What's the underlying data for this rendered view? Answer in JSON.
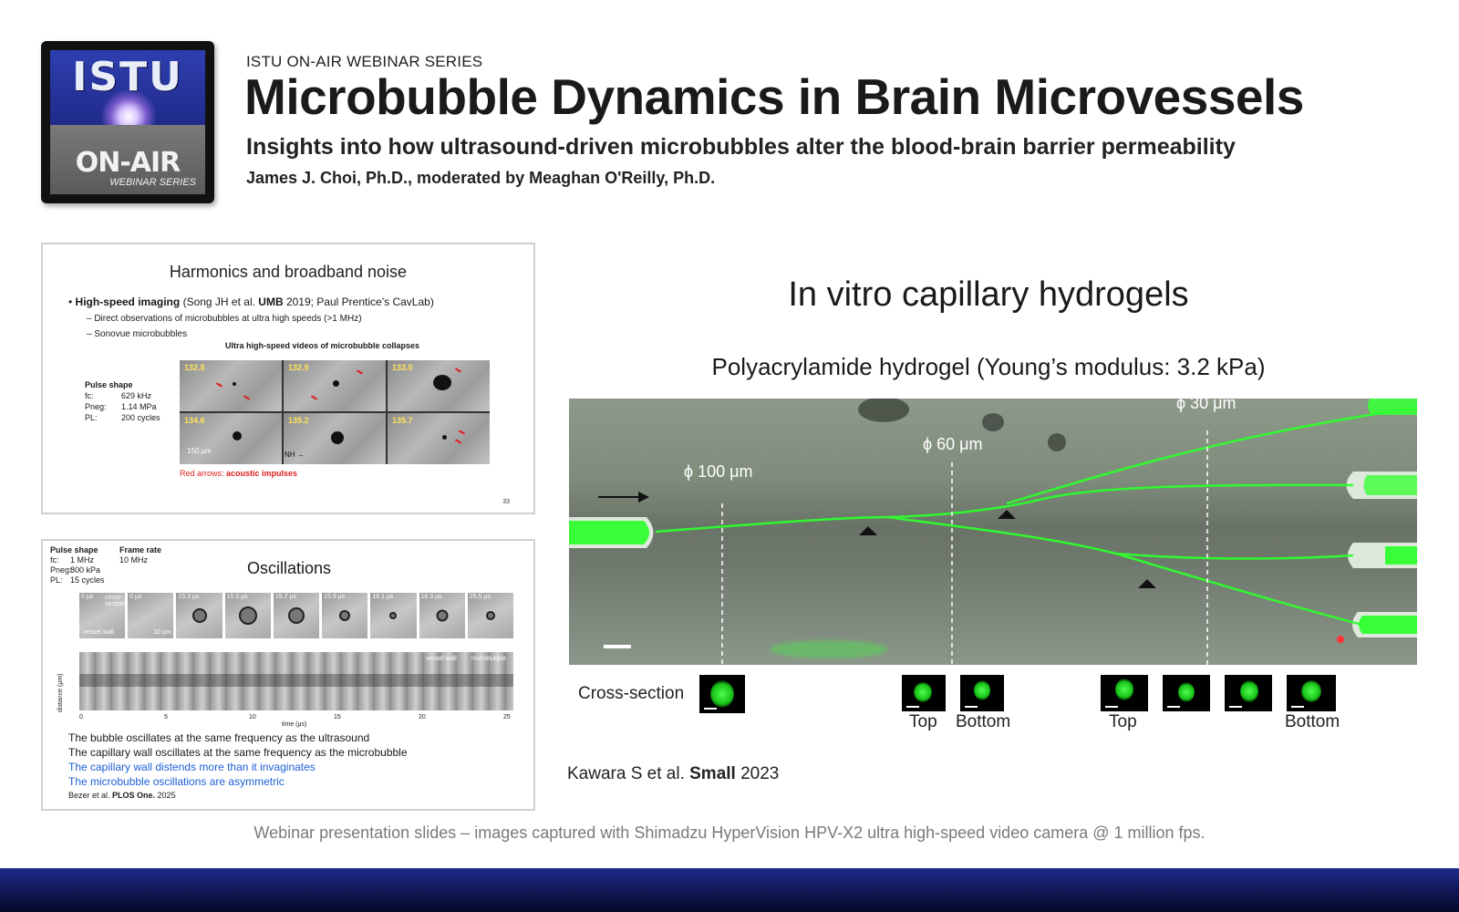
{
  "header": {
    "series": "ISTU ON-AIR WEBINAR SERIES",
    "title": "Microbubble Dynamics in Brain Microvessels",
    "subtitle": "Insights into how ultrasound-driven microbubbles alter the blood-brain barrier permeability",
    "authors": "James J. Choi, Ph.D., moderated by Meaghan O'Reilly, Ph.D."
  },
  "logo": {
    "top_text": "ISTU",
    "middle_text": "ON-AIR",
    "bottom_text": "WEBINAR SERIES"
  },
  "slide1": {
    "heading": "Harmonics and broadband noise",
    "bullet_bold": "High-speed imaging",
    "bullet_rest_1": " (Song JH et al. ",
    "bullet_bold_2": "UMB",
    "bullet_rest_2": " 2019; Paul Prentice’s CavLab)",
    "sub1": "–  Direct observations of microbubbles at ultra high speeds (>1 MHz)",
    "sub2": "–  Sonovue microbubbles",
    "video_title": "Ultra high-speed videos of microbubble collapses",
    "frames": [
      "132.8",
      "132.9",
      "133.0",
      "134.6",
      "135.2",
      "135.7"
    ],
    "pulse_title": "Pulse shape",
    "pulse_rows": [
      {
        "k": "fc:",
        "v": "629 kHz"
      },
      {
        "k": "Pneg:",
        "v": "1.14 MPa"
      },
      {
        "k": "PL:",
        "v": "200 cycles"
      }
    ],
    "scale": "150 μm",
    "nh": "NH →",
    "red_prefix": "Red arrows: ",
    "red_bold": "acoustic impulses",
    "page": "33"
  },
  "slide2": {
    "pulse_title": "Pulse shape",
    "pulse_rows": [
      {
        "k": "fc:",
        "v": "1 MHz"
      },
      {
        "k": "Pneg:",
        "v": "800 kPa"
      },
      {
        "k": "PL:",
        "v": "15 cycles"
      }
    ],
    "frame_title": "Frame rate",
    "frame_value": "10 MHz",
    "heading": "Oscillations",
    "frames": [
      "0 μs",
      "0 μs",
      "15.3 μs",
      "15.5 μs",
      "15.7 μs",
      "15.9 μs",
      "16.1 μs",
      "16.3 μs",
      "25.5 μs"
    ],
    "frame0_labels": [
      "cross-section",
      "vessel wall",
      "10 μm"
    ],
    "kymo_labels": [
      "vessel wall",
      "microbubble"
    ],
    "ylabel": "distance (μm)",
    "xlabel": "time (μs)",
    "xticks": [
      "0",
      "5",
      "10",
      "15",
      "20",
      "25"
    ],
    "lines": [
      "The bubble oscillates at the same frequency as the ultrasound",
      "The capillary wall oscillates at the same frequency as the microbubble"
    ],
    "blue_lines": [
      "The capillary wall distends more than it invaginates",
      "The microbubble oscillations are asymmetric"
    ],
    "cite_prefix": "Bezer et al. ",
    "cite_bold": "PLOS One.",
    "cite_year": " 2025"
  },
  "right": {
    "title": "In vitro capillary hydrogels",
    "subtitle": "Polyacrylamide hydrogel (Young’s modulus: 3.2 kPa)",
    "dims": [
      "ϕ 100 μm",
      "ϕ 60 μm",
      "ϕ 30 μm"
    ],
    "cross_section": "Cross-section",
    "labels": [
      "Top",
      "Bottom",
      "Top",
      "Bottom"
    ],
    "ref_prefix": "Kawara S et al. ",
    "ref_bold": "Small",
    "ref_year": " 2023"
  },
  "caption": "Webinar presentation slides – images captured with Shimadzu HyperVision HPV-X2 ultra high-speed video camera @ 1 million fps.",
  "colors": {
    "logo_blue": "#2f3fb0",
    "footer_navy": "#121a5c",
    "accent_green": "#33ff33",
    "text_blue": "#1d5fd6",
    "text_red": "#e02020"
  }
}
